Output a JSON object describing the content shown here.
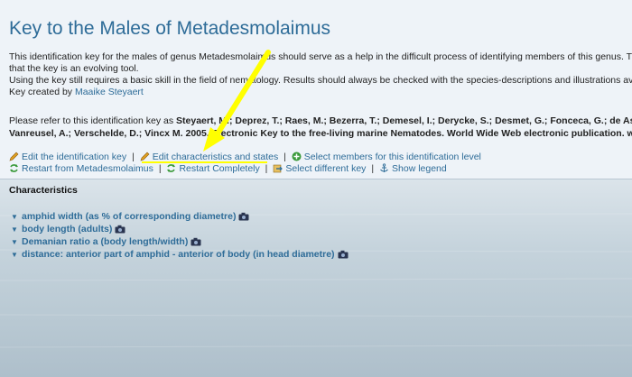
{
  "header": {
    "title": "Key to the Males of Metadesmolaimus",
    "intro_line1": "This identification key for the males of genus Metadesmolaimus should serve as a help in the difficult process of identifying members of this genus. The key",
    "intro_line2": "that the key is an evolving tool.",
    "intro_line3": "Using the key still requires a basic skill in the field of nematology. Results should always be checked with the species-descriptions and illustrations available",
    "created_by_prefix": "Key created by ",
    "created_by_name": "Maaike Steyaert",
    "cite_prefix": "Please refer to this identification key as ",
    "cite_bold_1": "Steyaert, M.; Deprez, T.; Raes, M.; Bezerra, T.; Demesel, I.; Derycke, S.; Desmet, G.; Fonceca, G.; de Assur",
    "cite_bold_2": "Vanreusel, A.; Verschelde, D.; Vincx M. 2005. Electronic Key to the free-living marine Nematodes. World Wide Web electronic publication. ww"
  },
  "actions": {
    "edit_key": "Edit the identification key",
    "edit_characteristics": "Edit characteristics and states",
    "select_members": "Select members for this identification level",
    "restart_from": "Restart from Metadesmolaimus",
    "restart_completely": "Restart Completely",
    "select_key": "Select different key",
    "show_legend": "Show legend",
    "separator": "|"
  },
  "characteristics": {
    "heading": "Characteristics",
    "items": [
      "amphid width (as % of corresponding diametre)",
      "body length (adults)",
      "Demanian ratio a (body length/width)",
      "distance: anterior part of amphid - anterior of body (in head diametre)"
    ]
  },
  "colors": {
    "link": "#2e6c98",
    "annotation": "#ffff00",
    "header_bg": "#eef3f8"
  }
}
